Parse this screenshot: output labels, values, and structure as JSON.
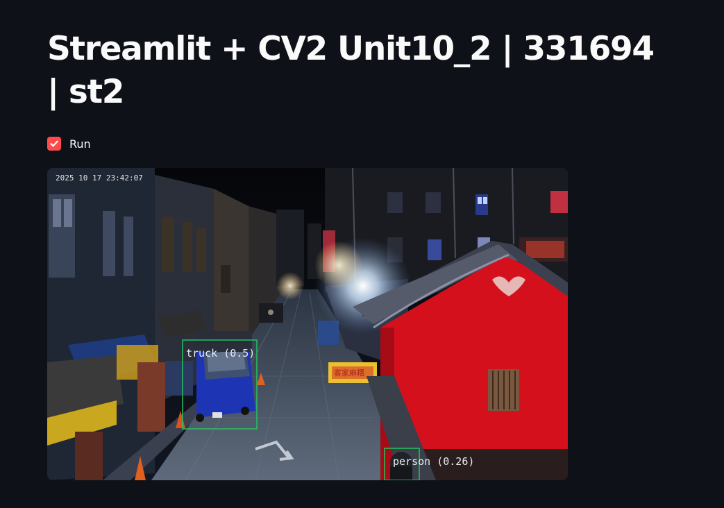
{
  "page": {
    "title": "Streamlit + CV2 Unit10_2 | 331694 | st2"
  },
  "controls": {
    "run_label": "Run",
    "run_checked": true
  },
  "video": {
    "timestamp": "2025 10 17 23:42:07",
    "detections": [
      {
        "label": "truck (0.5)"
      },
      {
        "label": "person (0.26)"
      }
    ],
    "sign_text": "客家麻糬",
    "box_color": "#22c55e"
  },
  "colors": {
    "background": "#0e1117",
    "accent": "#ff4b4b",
    "text": "#fafafa"
  }
}
